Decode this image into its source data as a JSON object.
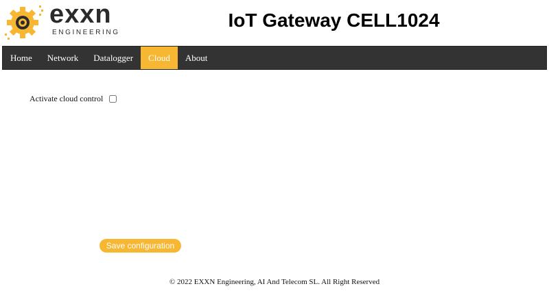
{
  "header": {
    "brand_name": "exxn",
    "brand_sub": "ENGINEERING",
    "title": "IoT Gateway CELL1024",
    "logo_icon": "gear-logo-icon",
    "logo_color": "#f7b733"
  },
  "nav": {
    "items": [
      {
        "label": "Home"
      },
      {
        "label": "Network"
      },
      {
        "label": "Datalogger"
      },
      {
        "label": "Cloud"
      },
      {
        "label": "About"
      }
    ],
    "active": "Cloud",
    "accent": "#f7b733",
    "background": "#333333"
  },
  "cloud": {
    "activate_label": "Activate cloud control",
    "activate_checked": false
  },
  "actions": {
    "save_label": "Save configuration"
  },
  "footer": {
    "copyright": "© 2022 EXXN Engineering, AI And Telecom SL. All Right Reserved"
  }
}
